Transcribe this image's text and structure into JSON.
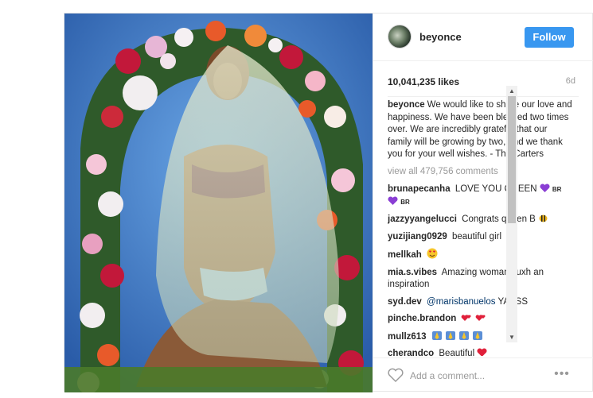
{
  "post": {
    "author": "beyonce",
    "follow_label": "Follow",
    "likes": "10,041,235 likes",
    "age": "6d",
    "caption_user": "beyonce",
    "caption_text": "We would like to share our love and happiness. We have been blessed two times over. We are incredibly grateful that our family will be growing by two, and we thank you for your well wishes. - The Carters",
    "view_all": "view all 479,756 comments",
    "comments": [
      {
        "user": "brunapecanha",
        "text": "LOVE YOU QUEEN",
        "emoji": [
          "purple-heart",
          "purple-heart"
        ],
        "suffix": "BR"
      },
      {
        "user": "jazzyyangelucci",
        "text": "Congrats queen B",
        "emoji": [
          "bee"
        ]
      },
      {
        "user": "yuzijiang0929",
        "text": "beautiful girl",
        "emoji": []
      },
      {
        "user": "mellkah",
        "text": "",
        "emoji": [
          "heart-eyes"
        ]
      },
      {
        "user": "mia.s.vibes",
        "text": "Amazing woman suxh an inspiration",
        "emoji": []
      },
      {
        "user": "syd.dev",
        "mention": "@marisbanuelos",
        "text": "YASSS",
        "emoji": []
      },
      {
        "user": "pinche.brandon",
        "text": "",
        "emoji": [
          "two-hearts",
          "two-hearts"
        ]
      },
      {
        "user": "mullz613",
        "text": "",
        "emoji": [
          "praying-hands",
          "praying-hands",
          "praying-hands",
          "praying-hands"
        ]
      },
      {
        "user": "cherandco",
        "text": "Beautiful",
        "emoji": [
          "heart"
        ]
      }
    ],
    "comment_placeholder": "Add a comment...",
    "more_label": "•••"
  },
  "colors": {
    "follow_bg": "#3897f0",
    "text": "#262626",
    "muted": "#999999",
    "mention": "#003569"
  }
}
